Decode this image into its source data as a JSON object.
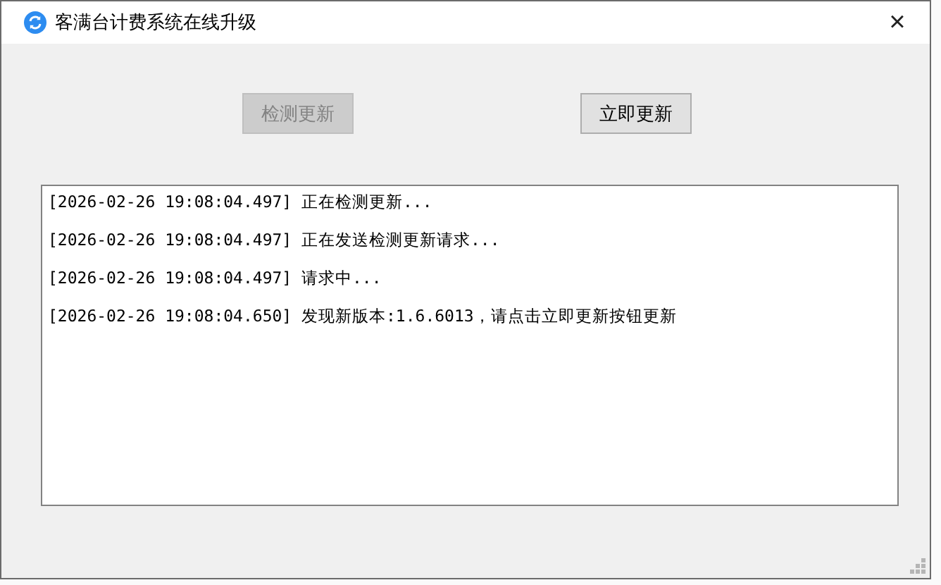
{
  "window": {
    "title": "客满台计费系统在线升级",
    "close": "×"
  },
  "buttons": [
    {
      "label": "检测更新",
      "disabled": true
    },
    {
      "label": "立即更新",
      "disabled": false
    }
  ],
  "log": [
    "[2026-02-26 19:08:04.497] 正在检测更新...",
    "[2026-02-26 19:08:04.497] 正在发送检测更新请求...",
    "[2026-02-26 19:08:04.497] 请求中...",
    "[2026-02-26 19:08:04.650] 发现新版本:1.6.6013，请点击立即更新按钮更新"
  ]
}
